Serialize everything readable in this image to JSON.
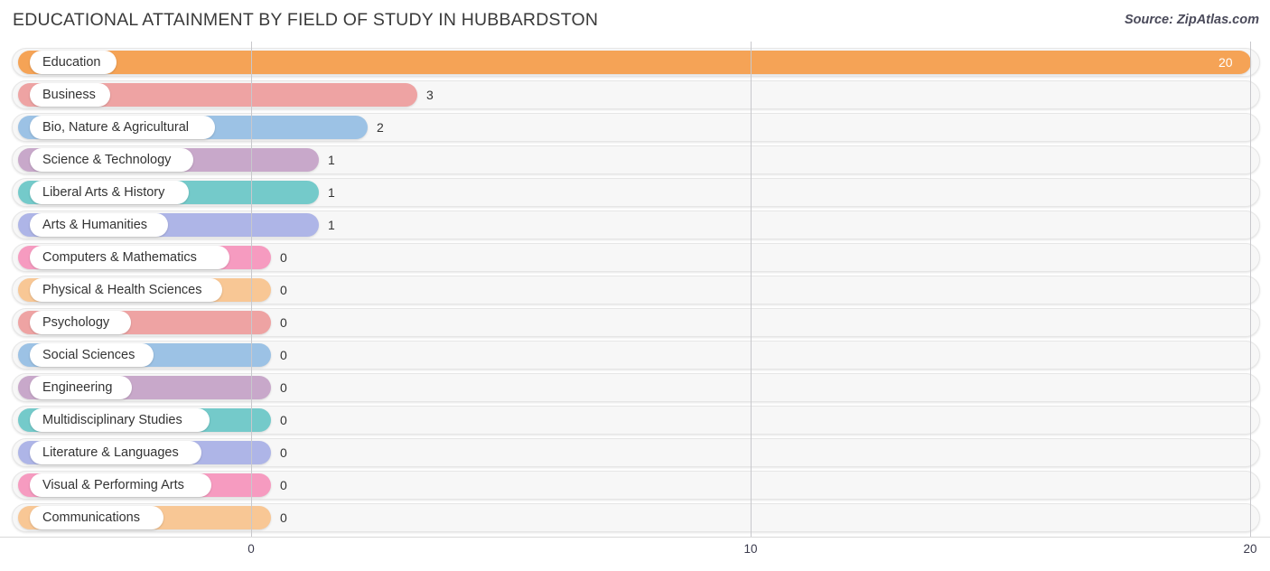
{
  "header": {
    "title": "EDUCATIONAL ATTAINMENT BY FIELD OF STUDY IN HUBBARDSTON",
    "source": "Source: ZipAtlas.com"
  },
  "chart_data": {
    "type": "bar",
    "orientation": "horizontal",
    "title": "EDUCATIONAL ATTAINMENT BY FIELD OF STUDY IN HUBBARDSTON",
    "xlabel": "",
    "ylabel": "",
    "xlim": [
      0,
      20
    ],
    "xticks": [
      0,
      10,
      20
    ],
    "xtick_labels": [
      "0",
      "10",
      "20"
    ],
    "grid": true,
    "legend": false,
    "categories": [
      "Education",
      "Business",
      "Bio, Nature & Agricultural",
      "Science & Technology",
      "Liberal Arts & History",
      "Arts & Humanities",
      "Computers & Mathematics",
      "Physical & Health Sciences",
      "Psychology",
      "Social Sciences",
      "Engineering",
      "Multidisciplinary Studies",
      "Literature & Languages",
      "Visual & Performing Arts",
      "Communications"
    ],
    "values": [
      20,
      3,
      2,
      1,
      1,
      1,
      0,
      0,
      0,
      0,
      0,
      0,
      0,
      0,
      0
    ],
    "value_labels": [
      "20",
      "3",
      "2",
      "1",
      "1",
      "1",
      "0",
      "0",
      "0",
      "0",
      "0",
      "0",
      "0",
      "0",
      "0"
    ],
    "colors": [
      "#F5A356",
      "#EEA3A3",
      "#9CC2E5",
      "#C8A8CA",
      "#74CACA",
      "#AEB5E7",
      "#F69BC0",
      "#F8C795",
      "#EEA3A3",
      "#9CC2E5",
      "#C8A8CA",
      "#74CACA",
      "#AEB5E7",
      "#F69BC0",
      "#F8C795"
    ]
  },
  "rows": [
    {
      "label": "Education",
      "value": "20",
      "color": "#F5A356",
      "bar_end": 1385,
      "pill_w": 96,
      "value_inside": true
    },
    {
      "label": "Business",
      "value": "3",
      "color": "#EEA3A3",
      "bar_end": 462,
      "pill_w": 89,
      "value_inside": false
    },
    {
      "label": "Bio, Nature & Agricultural",
      "value": "2",
      "color": "#9CC2E5",
      "bar_end": 407,
      "pill_w": 205,
      "value_inside": false
    },
    {
      "label": "Science & Technology",
      "value": "1",
      "color": "#C8A8CA",
      "bar_end": 353,
      "pill_w": 181,
      "value_inside": false
    },
    {
      "label": "Liberal Arts & History",
      "value": "1",
      "color": "#74CACA",
      "bar_end": 353,
      "pill_w": 176,
      "value_inside": false
    },
    {
      "label": "Arts & Humanities",
      "value": "1",
      "color": "#AEB5E7",
      "bar_end": 353,
      "pill_w": 153,
      "value_inside": false
    },
    {
      "label": "Computers & Mathematics",
      "value": "0",
      "color": "#F69BC0",
      "bar_end": 300,
      "pill_w": 221,
      "value_inside": false
    },
    {
      "label": "Physical & Health Sciences",
      "value": "0",
      "color": "#F8C795",
      "bar_end": 300,
      "pill_w": 213,
      "value_inside": false
    },
    {
      "label": "Psychology",
      "value": "0",
      "color": "#EEA3A3",
      "bar_end": 300,
      "pill_w": 112,
      "value_inside": false
    },
    {
      "label": "Social Sciences",
      "value": "0",
      "color": "#9CC2E5",
      "bar_end": 300,
      "pill_w": 137,
      "value_inside": false
    },
    {
      "label": "Engineering",
      "value": "0",
      "color": "#C8A8CA",
      "bar_end": 300,
      "pill_w": 113,
      "value_inside": false
    },
    {
      "label": "Multidisciplinary Studies",
      "value": "0",
      "color": "#74CACA",
      "bar_end": 300,
      "pill_w": 199,
      "value_inside": false
    },
    {
      "label": "Literature & Languages",
      "value": "0",
      "color": "#AEB5E7",
      "bar_end": 300,
      "pill_w": 190,
      "value_inside": false
    },
    {
      "label": "Visual & Performing Arts",
      "value": "0",
      "color": "#F69BC0",
      "bar_end": 300,
      "pill_w": 201,
      "value_inside": false
    },
    {
      "label": "Communications",
      "value": "0",
      "color": "#F8C795",
      "bar_end": 300,
      "pill_w": 148,
      "value_inside": false
    }
  ],
  "axis": {
    "ticks": [
      {
        "label": "0",
        "x": 278
      },
      {
        "label": "10",
        "x": 831
      },
      {
        "label": "20",
        "x": 1384
      }
    ]
  }
}
